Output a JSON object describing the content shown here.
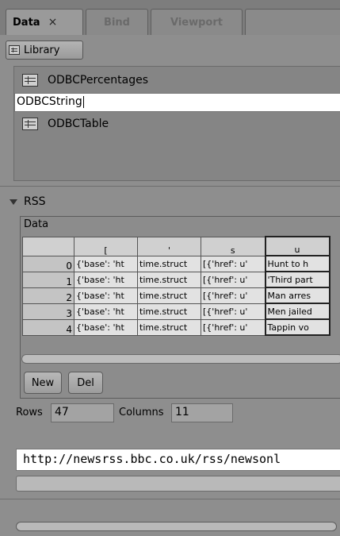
{
  "tabs": {
    "data": {
      "label": "Data",
      "close": "×"
    },
    "bind": {
      "label": "Bind"
    },
    "viewport": {
      "label": "Viewport"
    }
  },
  "library": {
    "button_label": "Library",
    "items": [
      {
        "label": "ODBCPercentages"
      },
      {
        "label": "ODBCString"
      },
      {
        "label": "ODBCTable"
      }
    ]
  },
  "rss": {
    "title": "RSS",
    "data_label": "Data",
    "columns": [
      "[",
      "'",
      "s",
      "u"
    ],
    "rows": [
      {
        "index": "0",
        "cells": [
          "{'base': 'ht",
          "time.struct",
          "[{'href': u'",
          "Hunt to h"
        ]
      },
      {
        "index": "1",
        "cells": [
          "{'base': 'ht",
          "time.struct",
          "[{'href': u'",
          "'Third part"
        ]
      },
      {
        "index": "2",
        "cells": [
          "{'base': 'ht",
          "time.struct",
          "[{'href': u'",
          "Man arres"
        ]
      },
      {
        "index": "3",
        "cells": [
          "{'base': 'ht",
          "time.struct",
          "[{'href': u'",
          "Men jailed"
        ]
      },
      {
        "index": "4",
        "cells": [
          "{'base': 'ht",
          "time.struct",
          "[{'href': u'",
          "Tappin vo"
        ]
      }
    ],
    "new_label": "New",
    "del_label": "Del",
    "rows_label": "Rows",
    "rows_value": "47",
    "columns_label": "Columns",
    "columns_value": "11",
    "url": "http://newsrss.bbc.co.uk/rss/newsonl"
  },
  "icons": {
    "library": "table-grid-icon",
    "collapse": "triangle-down-icon"
  }
}
